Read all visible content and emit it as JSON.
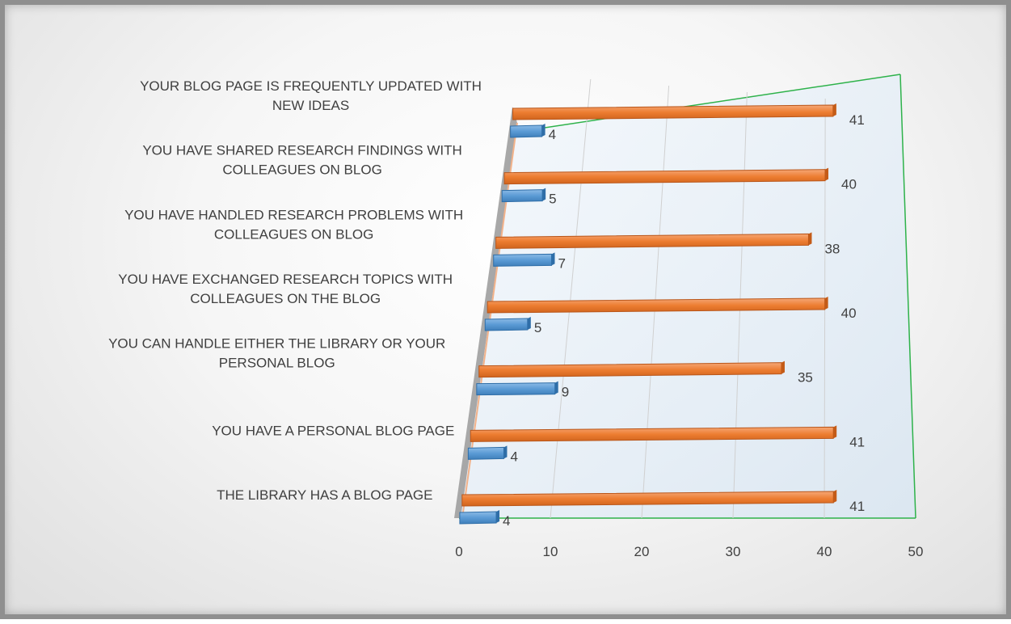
{
  "chart_data": {
    "type": "bar",
    "orientation": "horizontal",
    "style": "3d-perspective",
    "categories": [
      "THE LIBRARY HAS A BLOG PAGE",
      "YOU HAVE A PERSONAL BLOG PAGE",
      "YOU CAN HANDLE EITHER THE LIBRARY OR YOUR PERSONAL BLOG",
      "YOU HAVE EXCHANGED RESEARCH TOPICS WITH COLLEAGUES ON THE BLOG",
      "YOU HAVE HANDLED RESEARCH PROBLEMS WITH COLLEAGUES ON BLOG",
      "YOU HAVE SHARED RESEARCH FINDINGS WITH COLLEAGUES ON BLOG",
      "YOUR BLOG PAGE IS FREQUENTLY UPDATED WITH NEW IDEAS"
    ],
    "category_lines": [
      [
        "THE LIBRARY HAS A BLOG PAGE"
      ],
      [
        "YOU HAVE A PERSONAL BLOG PAGE"
      ],
      [
        "YOU CAN HANDLE EITHER THE LIBRARY OR YOUR",
        "PERSONAL BLOG"
      ],
      [
        "YOU HAVE EXCHANGED RESEARCH TOPICS WITH",
        "COLLEAGUES ON THE BLOG"
      ],
      [
        "YOU HAVE HANDLED RESEARCH PROBLEMS WITH",
        "COLLEAGUES ON BLOG"
      ],
      [
        "YOU HAVE SHARED RESEARCH FINDINGS WITH",
        "COLLEAGUES ON BLOG"
      ],
      [
        "YOUR BLOG PAGE IS FREQUENTLY UPDATED WITH",
        "NEW IDEAS"
      ]
    ],
    "series": [
      {
        "values": [
          4,
          4,
          9,
          5,
          7,
          5,
          4
        ],
        "color": "#5b9bd5"
      },
      {
        "values": [
          41,
          41,
          35,
          40,
          38,
          40,
          41
        ],
        "color": "#ed7d31"
      }
    ],
    "xlim": [
      0,
      50
    ],
    "xticks": [
      0,
      10,
      20,
      30,
      40,
      50
    ],
    "grid": true,
    "legend": "none"
  }
}
